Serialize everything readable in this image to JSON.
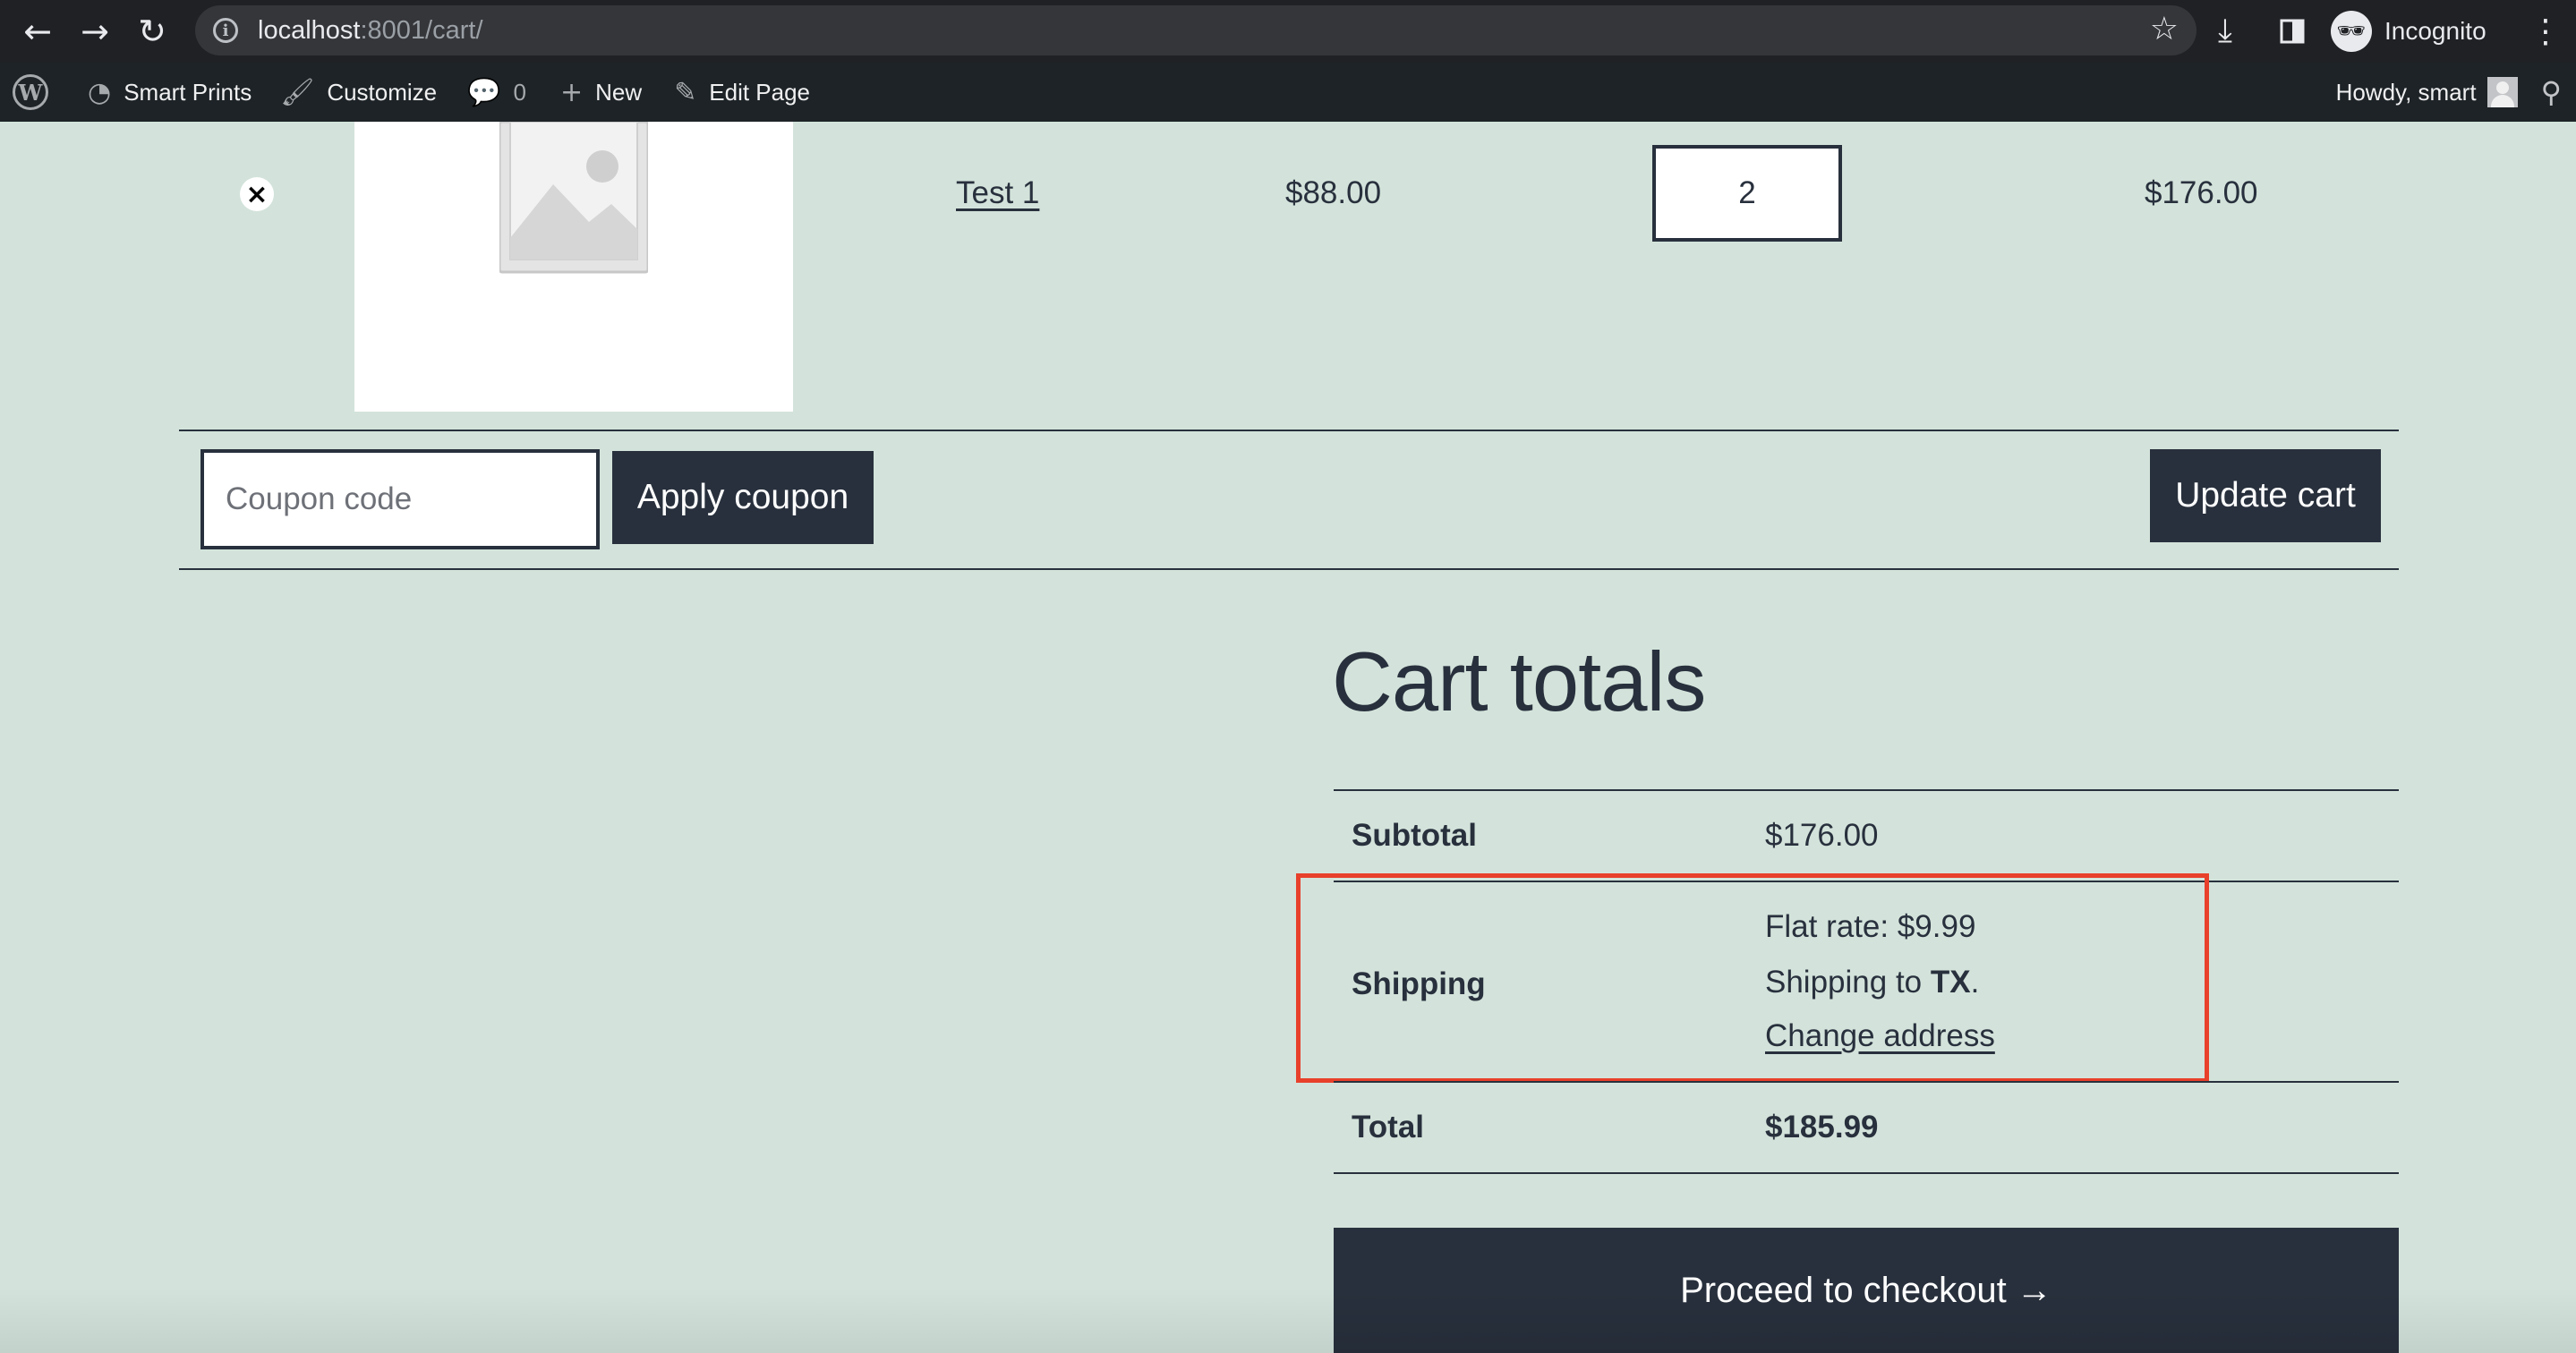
{
  "browser": {
    "url_host": "localhost",
    "url_path": ":8001/cart/",
    "incognito_label": "Incognito",
    "icons": [
      "back-arrow-icon",
      "forward-arrow-icon",
      "reload-icon",
      "site-info-icon",
      "bookmark-star-icon",
      "download-icon",
      "side-panel-icon",
      "incognito-icon",
      "kebab-menu-icon"
    ]
  },
  "admin_bar": {
    "site_name": "Smart Prints",
    "customize": "Customize",
    "comments_count": "0",
    "new": "New",
    "edit_page": "Edit Page",
    "howdy": "Howdy, smart"
  },
  "cart": {
    "item": {
      "name": "Test 1",
      "price": "$88.00",
      "quantity": "2",
      "subtotal": "$176.00"
    },
    "coupon_placeholder": "Coupon code",
    "apply_coupon": "Apply coupon",
    "update_cart": "Update cart"
  },
  "totals": {
    "title": "Cart totals",
    "subtotal_label": "Subtotal",
    "subtotal_value": "$176.00",
    "shipping_label": "Shipping",
    "shipping_method": "Flat rate: $9.99",
    "shipping_to_prefix": "Shipping to ",
    "shipping_state": "TX",
    "shipping_to_suffix": ".",
    "change_address": "Change address",
    "total_label": "Total",
    "total_value": "$185.99",
    "checkout_label": "Proceed to checkout →"
  },
  "colors": {
    "page_bg": "#d3e3db",
    "dark": "#28303d",
    "highlight": "#e8402b"
  }
}
